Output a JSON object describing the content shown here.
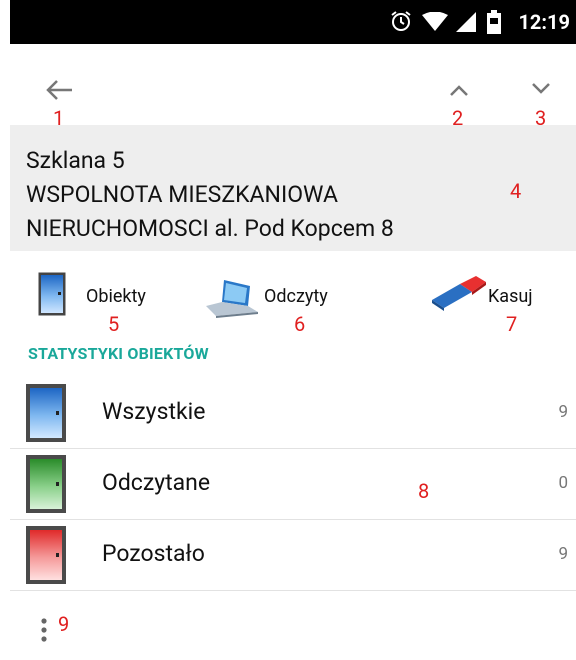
{
  "status_bar": {
    "time": "12:19",
    "icons": [
      "alarm-icon",
      "wifi-icon",
      "signal-icon",
      "battery-icon"
    ]
  },
  "annotations": {
    "a1": "1",
    "a2": "2",
    "a3": "3",
    "a4": "4",
    "a5": "5",
    "a6": "6",
    "a7": "7",
    "a8": "8",
    "a9": "9"
  },
  "header": {
    "line1": "Szklana 5",
    "line2": "WSPOLNOTA MIESZKANIOWA",
    "line3": "NIERUCHOMOSCI  al. Pod Kopcem 8"
  },
  "actions": {
    "obiekty": "Obiekty",
    "odczyty": "Odczyty",
    "kasuj": "Kasuj"
  },
  "section_title": "STATYSTYKI OBIEKTÓW",
  "rows": [
    {
      "label": "Wszystkie",
      "count": "9",
      "color": "#2f7fd6"
    },
    {
      "label": "Odczytane",
      "count": "0",
      "color": "#3ea33e"
    },
    {
      "label": "Pozostało",
      "count": "9",
      "color": "#e84848"
    }
  ],
  "colors": {
    "accent": "#1aa89a",
    "annotation": "#e02020"
  }
}
